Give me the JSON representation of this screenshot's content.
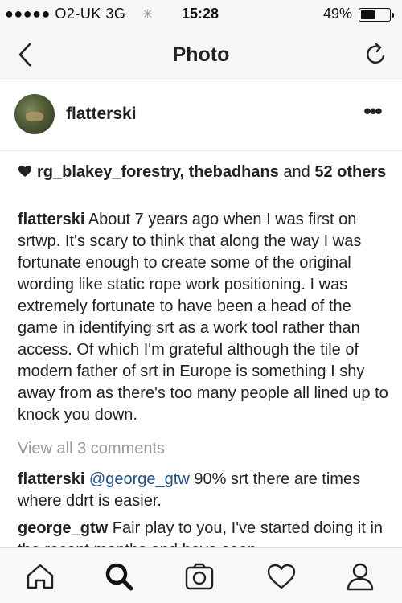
{
  "status_bar": {
    "carrier": "●●●●● O2-UK  3G",
    "time": "15:28",
    "battery_percent": "49%",
    "battery_level": 0.49,
    "activity_icon": "loading-spinner-icon"
  },
  "nav": {
    "title": "Photo",
    "back_icon": "chevron-left-icon",
    "refresh_icon": "refresh-icon"
  },
  "post": {
    "username": "flatterski",
    "more_icon": "more-horizontal-icon",
    "likes": {
      "users": "rg_blakey_forestry, thebadhans",
      "and_text": " and ",
      "others": "52 others"
    },
    "caption": {
      "user": "flatterski",
      "text": " About 7 years ago when I was first on srtwp. It's scary to think that along the way I was fortunate enough to create some of the original wording like static rope work positioning. I was extremely fortunate to have been a head of the game in identifying srt as a work tool rather than access. Of which I'm grateful although the tile of modern father of srt in Europe is something I shy away from as there's too many people all lined up to knock you down."
    },
    "view_comments": "View all 3 comments",
    "comments": [
      {
        "user": "flatterski",
        "mention": " @george_gtw",
        "text": " 90% srt there are times where ddrt is easier."
      },
      {
        "user": "george_gtw",
        "text": " Fair play to you, I've started doing it in the recent months and have seen"
      }
    ]
  },
  "tab_bar": {
    "items": [
      "home-icon",
      "search-icon",
      "camera-icon",
      "heart-icon",
      "profile-icon"
    ]
  },
  "colors": {
    "link": "#1f4f86",
    "muted": "#9a9a9a",
    "bar_background": "#f6f6f6"
  }
}
